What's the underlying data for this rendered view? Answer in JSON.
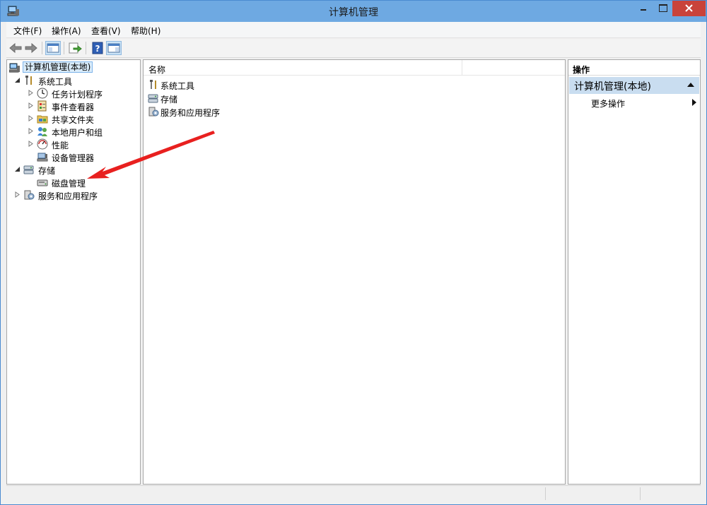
{
  "window": {
    "title": "计算机管理"
  },
  "menu": [
    {
      "label": "文件(F)"
    },
    {
      "label": "操作(A)"
    },
    {
      "label": "查看(V)"
    },
    {
      "label": "帮助(H)"
    }
  ],
  "tree": {
    "root": "计算机管理(本地)",
    "system_tools": "系统工具",
    "task_scheduler": "任务计划程序",
    "event_viewer": "事件查看器",
    "shared_folders": "共享文件夹",
    "local_users": "本地用户和组",
    "performance": "性能",
    "device_manager": "设备管理器",
    "storage": "存储",
    "disk_management": "磁盘管理",
    "services_apps": "服务和应用程序"
  },
  "list": {
    "column_name": "名称",
    "items": [
      {
        "label": "系统工具"
      },
      {
        "label": "存储"
      },
      {
        "label": "服务和应用程序"
      }
    ]
  },
  "actions": {
    "header": "操作",
    "section_title": "计算机管理(本地)",
    "more_actions": "更多操作"
  },
  "colors": {
    "titlebar": "#6ea9e2",
    "close_button": "#c9433a",
    "selection": "#d9ebf9",
    "action_section": "#c9ddf0",
    "annotation_arrow": "#e8201f"
  }
}
